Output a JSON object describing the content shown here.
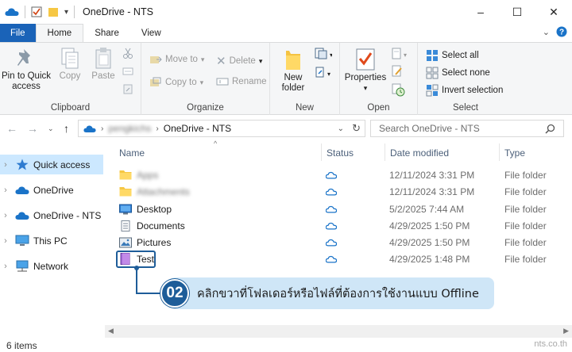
{
  "window": {
    "title": "OneDrive - NTS",
    "controls": {
      "minimize": "–",
      "maximize": "☐",
      "close": "✕"
    }
  },
  "ribbon_tabs": [
    "File",
    "Home",
    "Share",
    "View"
  ],
  "ribbon": {
    "clipboard": {
      "label": "Clipboard",
      "pin": "Pin to Quick access",
      "copy": "Copy",
      "paste": "Paste"
    },
    "organize": {
      "label": "Organize",
      "move_to": "Move to",
      "copy_to": "Copy to",
      "delete": "Delete",
      "rename": "Rename"
    },
    "new": {
      "label": "New",
      "new_folder": "New folder"
    },
    "open": {
      "label": "Open",
      "properties": "Properties"
    },
    "select": {
      "label": "Select",
      "select_all": "Select all",
      "select_none": "Select none",
      "invert": "Invert selection"
    }
  },
  "address": {
    "path_blurred": "pengkichs",
    "current": "OneDrive - NTS",
    "search_placeholder": "Search OneDrive - NTS"
  },
  "nav_pane": [
    {
      "label": "Quick access",
      "icon": "star-icon",
      "selected": true
    },
    {
      "label": "OneDrive",
      "icon": "cloud-icon",
      "selected": false
    },
    {
      "label": "OneDrive - NTS",
      "icon": "cloud-icon",
      "selected": false
    },
    {
      "label": "This PC",
      "icon": "pc-icon",
      "selected": false
    },
    {
      "label": "Network",
      "icon": "network-icon",
      "selected": false
    }
  ],
  "columns": {
    "name": "Name",
    "status": "Status",
    "date": "Date modified",
    "type": "Type"
  },
  "files": [
    {
      "name": "Apps",
      "blurred": true,
      "icon": "folder-icon",
      "date": "12/11/2024 3:31 PM",
      "type": "File folder"
    },
    {
      "name": "Attachments",
      "blurred": true,
      "icon": "folder-icon",
      "date": "12/11/2024 3:31 PM",
      "type": "File folder"
    },
    {
      "name": "Desktop",
      "blurred": false,
      "icon": "desktop-folder-icon",
      "date": "5/2/2025 7:44 AM",
      "type": "File folder"
    },
    {
      "name": "Documents",
      "blurred": false,
      "icon": "documents-folder-icon",
      "date": "4/29/2025 1:50 PM",
      "type": "File folder"
    },
    {
      "name": "Pictures",
      "blurred": false,
      "icon": "pictures-folder-icon",
      "date": "4/29/2025 1:50 PM",
      "type": "File folder"
    },
    {
      "name": "Test",
      "blurred": false,
      "icon": "purple-folder-icon",
      "date": "4/29/2025 1:48 PM",
      "type": "File folder"
    }
  ],
  "status_bar": {
    "count": "6 items"
  },
  "annotation": {
    "step": "02",
    "text": "คลิกขวาที่โฟลเดอร์หรือไฟล์ที่ต้องการใช้งานแบบ Offline"
  },
  "watermark": "nts.co.th",
  "colors": {
    "accent": "#1a63b8",
    "callout_bg": "#cfe6f7",
    "badge": "#1e5d99",
    "selection": "#cce8ff"
  }
}
